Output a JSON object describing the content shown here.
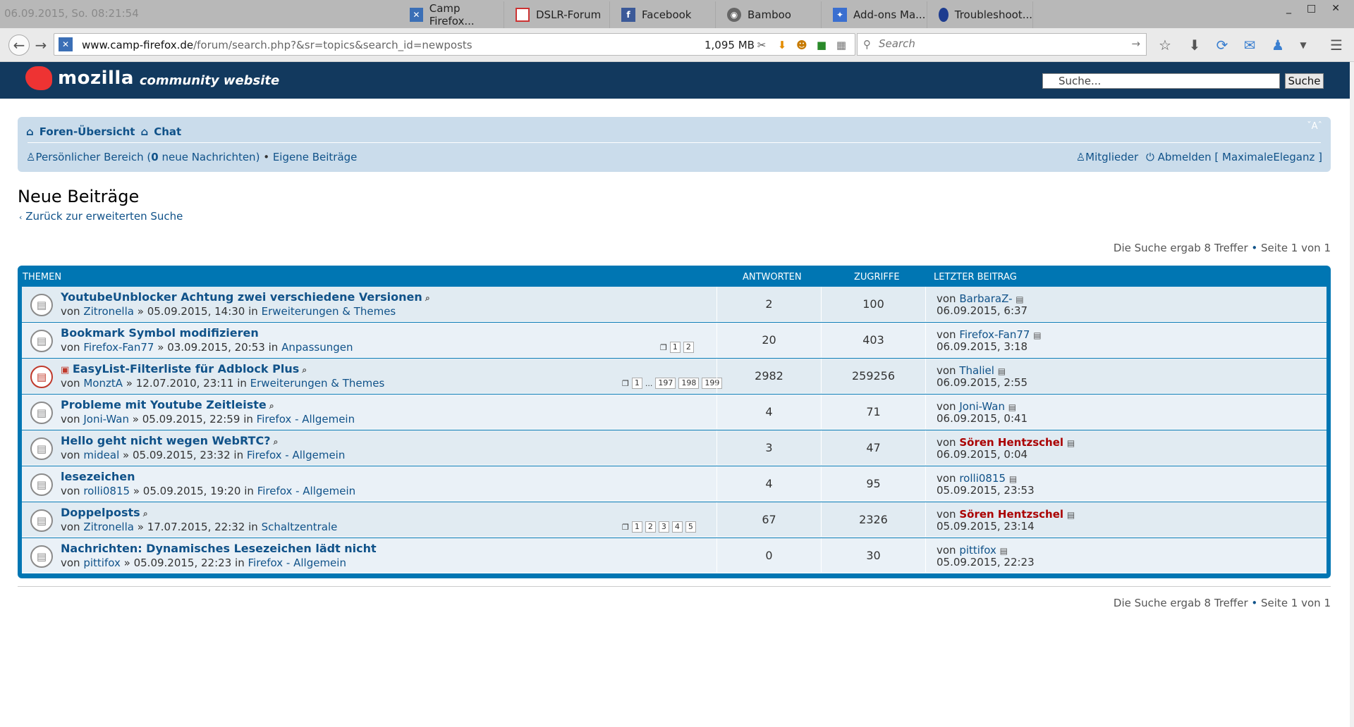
{
  "window": {
    "clock": "06.09.2015, So. 08:21:54",
    "tabs": [
      {
        "label": "Camp Firefox...",
        "icon": "camp-firefox-icon"
      },
      {
        "label": "DSLR-Forum",
        "icon": "dslr-icon"
      },
      {
        "label": "Facebook",
        "icon": "facebook-icon"
      },
      {
        "label": "Bamboo",
        "icon": "rss-icon"
      },
      {
        "label": "Add-ons Ma...",
        "icon": "puzzle-icon"
      },
      {
        "label": "Troubleshoot...",
        "icon": "globe-icon"
      }
    ],
    "controls": [
      "_",
      "□",
      "✕"
    ]
  },
  "nav": {
    "url_host": "www.camp-firefox.de",
    "url_path": "/forum/search.php?&sr=topics&search_id=newposts",
    "memory": "1,095 MB",
    "search_placeholder": "Search"
  },
  "site": {
    "brand": "mozilla",
    "tagline": "community website",
    "search_value": "Suche...",
    "search_button": "Suche"
  },
  "crumbs": {
    "home": "Foren-Übersicht",
    "chat": "Chat",
    "fontsize": "A",
    "personal_prefix": "Persönlicher Bereich (",
    "personal_count": "0",
    "personal_suffix": " neue Nachrichten)",
    "own_posts": "Eigene Beiträge",
    "members": "Mitglieder",
    "logout": "Abmelden [ MaximaleEleganz ]"
  },
  "page": {
    "title": "Neue Beiträge",
    "back": "Zurück zur erweiterten Suche",
    "results": "Die Suche ergab 8 Treffer",
    "page_info": "Seite 1 von 1"
  },
  "table": {
    "headers": {
      "topics": "THEMEN",
      "replies": "ANTWORTEN",
      "views": "ZUGRIFFE",
      "last": "LETZTER BEITRAG"
    },
    "rows": [
      {
        "title": "YoutubeUnblocker Achtung zwei verschiedene Versionen",
        "attach": true,
        "sticky": false,
        "author": "Zitronella",
        "date": "05.09.2015, 14:30",
        "forum": "Erweiterungen & Themes",
        "pages": [],
        "replies": "2",
        "views": "100",
        "last_author": "BarbaraZ-",
        "last_admin": false,
        "last_date": "06.09.2015, 6:37"
      },
      {
        "title": "Bookmark Symbol modifizieren",
        "attach": false,
        "sticky": false,
        "author": "Firefox-Fan77",
        "date": "03.09.2015, 20:53",
        "forum": "Anpassungen",
        "pages": [
          "1",
          "2"
        ],
        "replies": "20",
        "views": "403",
        "last_author": "Firefox-Fan77",
        "last_admin": false,
        "last_date": "06.09.2015, 3:18"
      },
      {
        "title": "EasyList-Filterliste für Adblock Plus",
        "attach": true,
        "sticky": true,
        "author": "MonztA",
        "date": "12.07.2010, 23:11",
        "forum": "Erweiterungen & Themes",
        "pages": [
          "1",
          "...",
          "197",
          "198",
          "199"
        ],
        "replies": "2982",
        "views": "259256",
        "last_author": "Thaliel",
        "last_admin": false,
        "last_date": "06.09.2015, 2:55"
      },
      {
        "title": "Probleme mit Youtube Zeitleiste",
        "attach": true,
        "sticky": false,
        "author": "Joni-Wan",
        "date": "05.09.2015, 22:59",
        "forum": "Firefox - Allgemein",
        "pages": [],
        "replies": "4",
        "views": "71",
        "last_author": "Joni-Wan",
        "last_admin": false,
        "last_date": "06.09.2015, 0:41"
      },
      {
        "title": "Hello geht nicht wegen WebRTC?",
        "attach": true,
        "sticky": false,
        "author": "mideal",
        "date": "05.09.2015, 23:32",
        "forum": "Firefox - Allgemein",
        "pages": [],
        "replies": "3",
        "views": "47",
        "last_author": "Sören Hentzschel",
        "last_admin": true,
        "last_date": "06.09.2015, 0:04"
      },
      {
        "title": "lesezeichen",
        "attach": false,
        "sticky": false,
        "author": "rolli0815",
        "date": "05.09.2015, 19:20",
        "forum": "Firefox - Allgemein",
        "pages": [],
        "replies": "4",
        "views": "95",
        "last_author": "rolli0815",
        "last_admin": false,
        "last_date": "05.09.2015, 23:53"
      },
      {
        "title": "Doppelposts",
        "attach": true,
        "sticky": false,
        "author": "Zitronella",
        "date": "17.07.2015, 22:32",
        "forum": "Schaltzentrale",
        "pages": [
          "1",
          "2",
          "3",
          "4",
          "5"
        ],
        "replies": "67",
        "views": "2326",
        "last_author": "Sören Hentzschel",
        "last_admin": true,
        "last_date": "05.09.2015, 23:14"
      },
      {
        "title": "Nachrichten: Dynamisches Lesezeichen lädt nicht",
        "attach": false,
        "sticky": false,
        "author": "pittifox",
        "date": "05.09.2015, 22:23",
        "forum": "Firefox - Allgemein",
        "pages": [],
        "replies": "0",
        "views": "30",
        "last_author": "pittifox",
        "last_admin": false,
        "last_date": "05.09.2015, 22:23"
      }
    ]
  },
  "labels": {
    "by": "von",
    "in": "in",
    "sep": "»"
  }
}
